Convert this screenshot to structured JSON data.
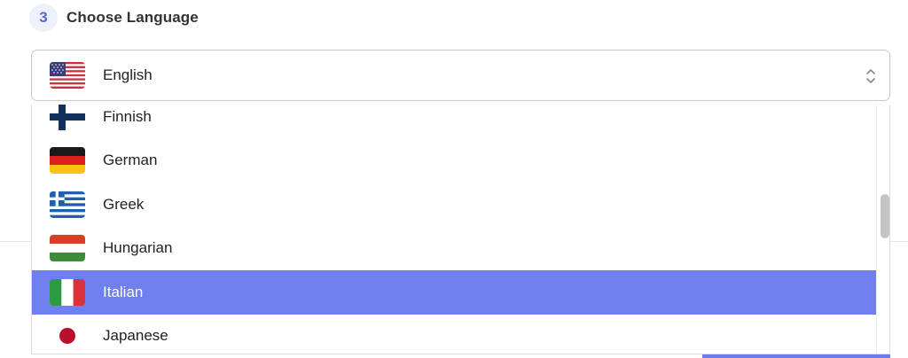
{
  "step": {
    "number": "3",
    "title": "Choose Language"
  },
  "select": {
    "value": "English",
    "flag": "us-flag-icon"
  },
  "dropdown": {
    "options": [
      {
        "label": "Finnish",
        "flag": "finland-flag-icon",
        "selected": false
      },
      {
        "label": "German",
        "flag": "germany-flag-icon",
        "selected": false
      },
      {
        "label": "Greek",
        "flag": "greece-flag-icon",
        "selected": false
      },
      {
        "label": "Hungarian",
        "flag": "hungary-flag-icon",
        "selected": false
      },
      {
        "label": "Italian",
        "flag": "italy-flag-icon",
        "selected": true
      },
      {
        "label": "Japanese",
        "flag": "japan-flag-icon",
        "selected": false
      }
    ]
  },
  "colors": {
    "accent": "#6f80ec",
    "step_badge_bg": "#eef0fb",
    "step_badge_text": "#5b66d6"
  }
}
